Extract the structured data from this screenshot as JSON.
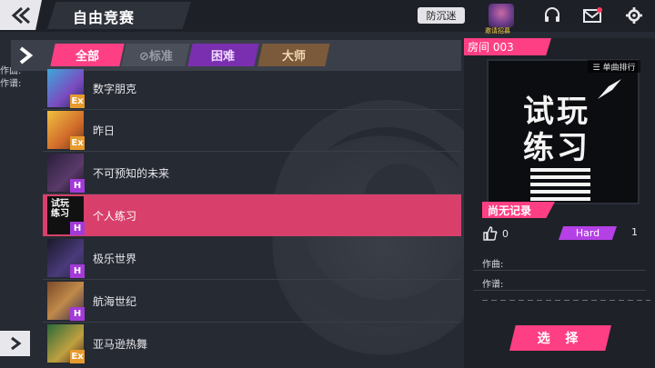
{
  "header": {
    "title": "自由竞赛",
    "anti_addiction_label": "防沉迷",
    "avatar_label": "邀请招募",
    "icons": [
      "back-icon",
      "headset-icon",
      "mail-icon",
      "gear-icon"
    ]
  },
  "filters": {
    "tabs": [
      "全部",
      "⊘标准",
      "困难",
      "大师"
    ],
    "selected": "全部"
  },
  "left_clip": {
    "line1": "作曲:",
    "line2": "作谱:"
  },
  "songs": [
    {
      "name": "数字朋克",
      "difficulty": "Ex"
    },
    {
      "name": "昨日",
      "difficulty": "Ex"
    },
    {
      "name": "不可预知的未来",
      "difficulty": "H"
    },
    {
      "name": "个人练习",
      "difficulty": "H"
    },
    {
      "name": "极乐世界",
      "difficulty": "H"
    },
    {
      "name": "航海世纪",
      "difficulty": "H"
    },
    {
      "name": "亚马逊热舞",
      "difficulty": "Ex"
    }
  ],
  "selected_song": {
    "room_label": "房间  003",
    "cover_text_1": "试玩",
    "cover_text_2": "练习",
    "rank_button": "☰ 单曲排行",
    "record_status": "尚无记录",
    "likes": "0",
    "difficulty_label": "Hard",
    "level": "1",
    "composer_label": "作曲:",
    "chart_label": "作谱:",
    "select_button": "选 择"
  },
  "colors": {
    "accent": "#ff3f83",
    "hard": "#a33ad8",
    "ex": "#e79a2e"
  }
}
